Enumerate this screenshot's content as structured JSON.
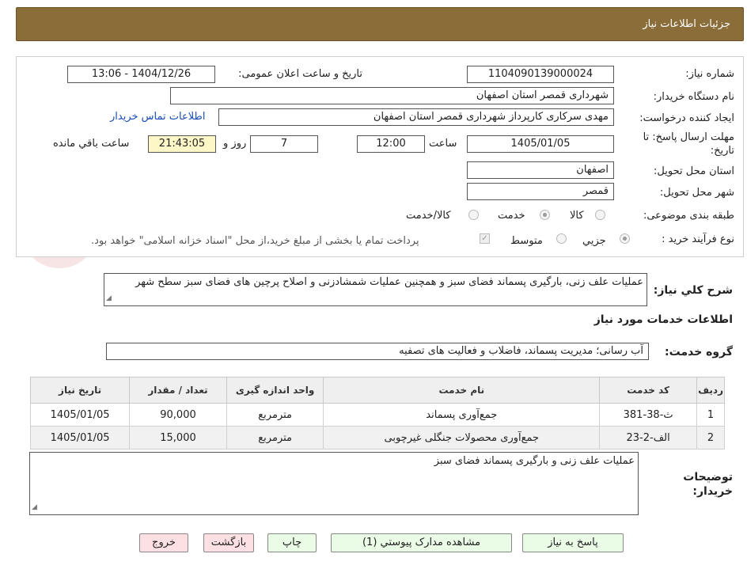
{
  "header": {
    "title": "جزئیات اطلاعات نیاز"
  },
  "form": {
    "need_number_label": "شماره نیاز:",
    "need_number": "1104090139000024",
    "announce_label": "تاریخ و ساعت اعلان عمومی:",
    "announce_value": "1404/12/26 - 13:06",
    "buyer_org_label": "نام دستگاه خریدار:",
    "buyer_org": "شهرداری قمصر استان اصفهان",
    "creator_label": "ایجاد کننده درخواست:",
    "creator": "مهدی سرکاری کارپرداز شهرداری قمصر استان اصفهان",
    "contact_link": "اطلاعات تماس خریدار",
    "deadline_label": "مهلت ارسال پاسخ: تا تاریخ:",
    "deadline_date": "1405/01/05",
    "time_label": "ساعت",
    "deadline_time": "12:00",
    "days_value": "7",
    "days_label": "روز و",
    "remaining_time": "21:43:05",
    "remaining_label": "ساعت باقي مانده",
    "province_label": "استان محل تحویل:",
    "province": "اصفهان",
    "city_label": "شهر محل تحویل:",
    "city": "قمصر",
    "category_label": "طبقه بندی موضوعی:",
    "category_options": [
      "کالا",
      "خدمت",
      "کالا/خدمت"
    ],
    "category_selected": "خدمت",
    "process_label": "نوع فرآیند خرید :",
    "process_options": [
      "جزيي",
      "متوسط"
    ],
    "process_selected": "جزيي",
    "payment_note": "پرداخت تمام یا بخشی از مبلغ خرید،از محل \"اسناد خزانه اسلامی\" خواهد بود."
  },
  "summary": {
    "label": "شرح کلي نياز:",
    "text": "عملیات علف زنی، بارگیری پسماند فضای سبز و همچنین عملیات شمشادزنی و اصلاح پرچین های فضای سبز سطح شهر"
  },
  "services": {
    "section_title": "اطلاعات خدمات مورد نیاز",
    "group_label": "گروه خدمت:",
    "group_value": "آب رسانی؛ مدیریت پسماند، فاضلاب و فعالیت های تصفیه",
    "columns": [
      "ردیف",
      "کد خدمت",
      "نام خدمت",
      "واحد اندازه گیری",
      "تعداد / مقدار",
      "تاریخ نیاز"
    ],
    "rows": [
      {
        "row": "1",
        "code": "ث-38-381",
        "name": "جمع‌آوری پسماند",
        "unit": "مترمربع",
        "qty": "90,000",
        "date": "1405/01/05"
      },
      {
        "row": "2",
        "code": "الف-2-23",
        "name": "جمع‌آوری محصولات جنگلی غیرچوبی",
        "unit": "مترمربع",
        "qty": "15,000",
        "date": "1405/01/05"
      }
    ]
  },
  "buyer_notes": {
    "label": "توضیحات خریدار:",
    "text": "عملیات علف زنی و بارگیری پسماند فضای سبز"
  },
  "buttons": {
    "reply": "پاسخ به نیاز",
    "attachments": "مشاهده مدارک پیوستي (1)",
    "print": "چاپ",
    "back": "بازگشت",
    "exit": "خروج"
  },
  "watermark": {
    "text": "AriaTender.neT"
  },
  "colors": {
    "header_bg": "#8b6d3a",
    "link": "#1a4db5",
    "green_button": "#eafbe6",
    "pink_button": "#fde0e4",
    "timer_bg": "#fdf7c8"
  }
}
